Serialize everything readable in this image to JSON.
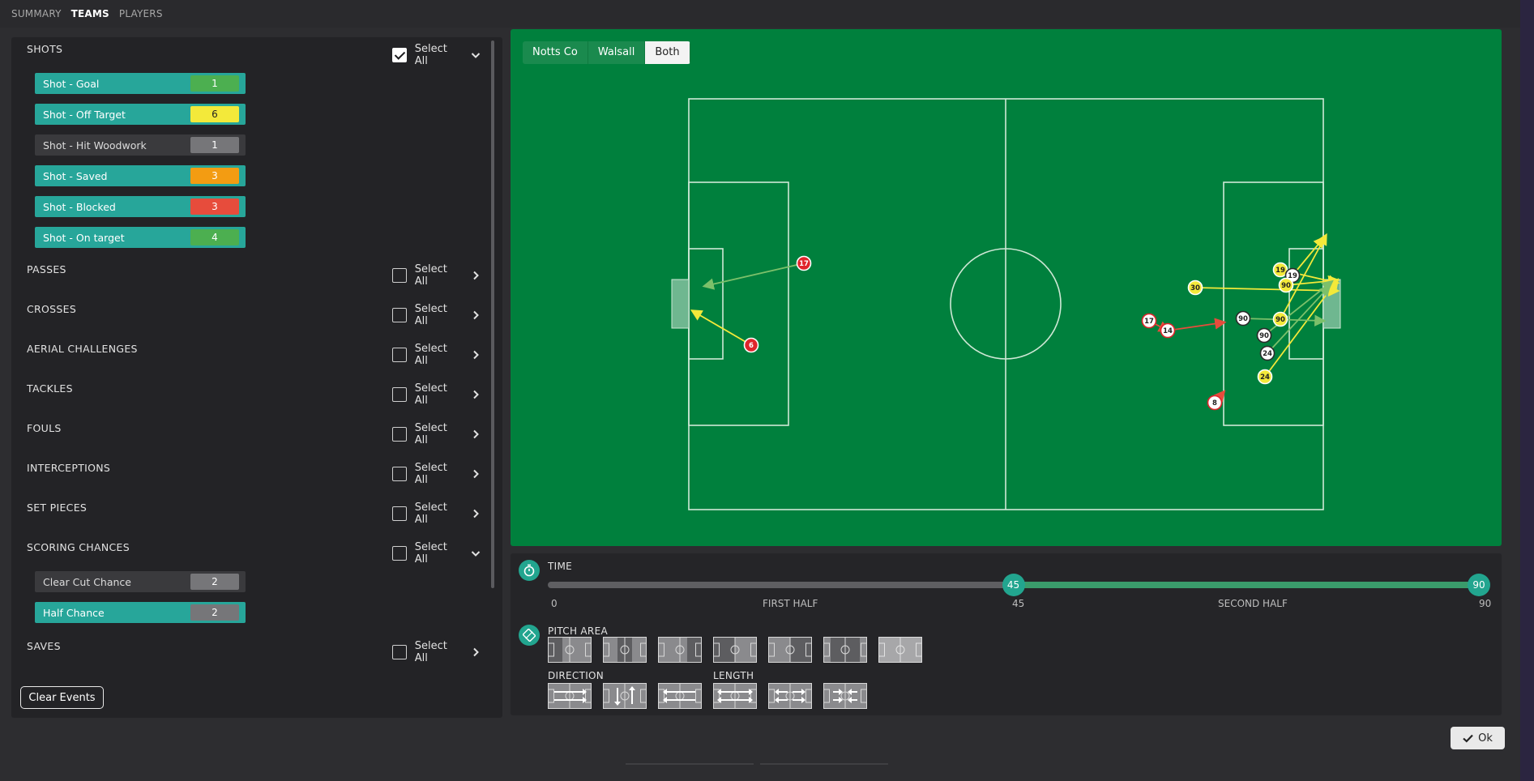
{
  "tabs": [
    {
      "label": "SUMMARY",
      "active": false
    },
    {
      "label": "TEAMS",
      "active": true
    },
    {
      "label": "PLAYERS",
      "active": false
    }
  ],
  "categories": [
    {
      "id": "shots",
      "title": "SHOTS",
      "select_all": "Select All",
      "checked": true,
      "expanded": true,
      "events": [
        {
          "label": "Shot - Goal",
          "count": "1",
          "on": true,
          "badge": "#4caf50",
          "badge_text": "#ffffff"
        },
        {
          "label": "Shot - Off Target",
          "count": "6",
          "on": true,
          "badge": "#f3e93a",
          "badge_text": "#222222"
        },
        {
          "label": "Shot - Hit Woodwork",
          "count": "1",
          "on": false,
          "badge": "#767679",
          "badge_text": "#ffffff"
        },
        {
          "label": "Shot - Saved",
          "count": "3",
          "on": true,
          "badge": "#f39c12",
          "badge_text": "#ffffff"
        },
        {
          "label": "Shot - Blocked",
          "count": "3",
          "on": true,
          "badge": "#e74c3c",
          "badge_text": "#ffffff"
        },
        {
          "label": "Shot - On target",
          "count": "4",
          "on": true,
          "badge": "#4caf50",
          "badge_text": "#ffffff"
        }
      ]
    },
    {
      "id": "passes",
      "title": "PASSES",
      "select_all": "Select All",
      "checked": false,
      "expanded": false
    },
    {
      "id": "crosses",
      "title": "CROSSES",
      "select_all": "Select All",
      "checked": false,
      "expanded": false
    },
    {
      "id": "aerial",
      "title": "AERIAL CHALLENGES",
      "select_all": "Select All",
      "checked": false,
      "expanded": false
    },
    {
      "id": "tackles",
      "title": "TACKLES",
      "select_all": "Select All",
      "checked": false,
      "expanded": false
    },
    {
      "id": "fouls",
      "title": "FOULS",
      "select_all": "Select All",
      "checked": false,
      "expanded": false
    },
    {
      "id": "interceptions",
      "title": "INTERCEPTIONS",
      "select_all": "Select All",
      "checked": false,
      "expanded": false
    },
    {
      "id": "setpieces",
      "title": "SET PIECES",
      "select_all": "Select All",
      "checked": false,
      "expanded": false
    },
    {
      "id": "scoring",
      "title": "SCORING CHANCES",
      "select_all": "Select All",
      "checked": false,
      "expanded": true,
      "events": [
        {
          "label": "Clear Cut Chance",
          "count": "2",
          "on": false,
          "badge": "#767679",
          "badge_text": "#ffffff"
        },
        {
          "label": "Half Chance",
          "count": "2",
          "on": true,
          "badge": "#767679",
          "badge_text": "#ffffff"
        }
      ]
    },
    {
      "id": "saves",
      "title": "SAVES",
      "select_all": "Select All",
      "checked": false,
      "expanded": false
    }
  ],
  "clear_events": "Clear Events",
  "team_tabs": [
    {
      "label": "Notts Co",
      "active": false
    },
    {
      "label": "Walsall",
      "active": false
    },
    {
      "label": "Both",
      "active": true
    }
  ],
  "markers": [
    {
      "label": "17",
      "style": "red"
    },
    {
      "label": "6",
      "style": "red"
    },
    {
      "label": "19",
      "style": "yellow"
    },
    {
      "label": "19",
      "style": "white"
    },
    {
      "label": "90",
      "style": "yellow"
    },
    {
      "label": "30",
      "style": "yellow"
    },
    {
      "label": "90",
      "style": "white"
    },
    {
      "label": "90",
      "style": "yellow"
    },
    {
      "label": "90",
      "style": "white"
    },
    {
      "label": "17",
      "style": "white-red"
    },
    {
      "label": "14",
      "style": "white-red"
    },
    {
      "label": "24",
      "style": "white"
    },
    {
      "label": "24",
      "style": "yellow"
    },
    {
      "label": "8",
      "style": "white-red"
    }
  ],
  "time": {
    "title": "TIME",
    "start": "0",
    "first_half": "FIRST HALF",
    "mid": "45",
    "second_half": "SECOND HALF",
    "end": "90",
    "handle_left": "45",
    "handle_right": "90",
    "range": [
      45,
      90
    ],
    "max": 90
  },
  "pitch_area": {
    "title": "PITCH AREA",
    "selected_index": 6,
    "count": 7
  },
  "direction": {
    "title": "DIRECTION",
    "count": 3
  },
  "length": {
    "title": "LENGTH",
    "count": 3
  },
  "ok": "Ok",
  "colors": {
    "pitch": "#00803d",
    "teal": "#27a69a",
    "handle": "#22a58f"
  }
}
